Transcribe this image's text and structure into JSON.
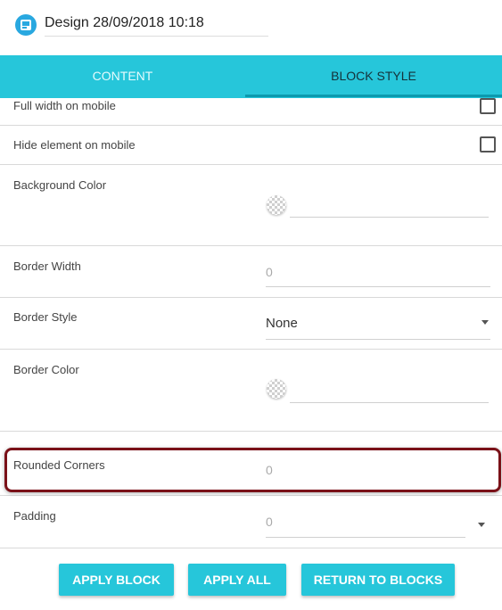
{
  "header": {
    "title": "Design 28/09/2018 10:18",
    "logo_icon": "design-logo-icon"
  },
  "tabs": [
    {
      "label": "CONTENT",
      "active": false
    },
    {
      "label": "BLOCK STYLE",
      "active": true
    }
  ],
  "rows": {
    "full_width_mobile": {
      "label": "Full width on mobile",
      "checked": false
    },
    "hide_on_mobile": {
      "label": "Hide element on mobile",
      "checked": false
    },
    "background_color": {
      "label": "Background Color",
      "value": ""
    },
    "border_width": {
      "label": "Border Width",
      "placeholder": "0"
    },
    "border_style": {
      "label": "Border Style",
      "value": "None"
    },
    "border_color": {
      "label": "Border Color",
      "value": ""
    },
    "rounded_corners": {
      "label": "Rounded Corners",
      "placeholder": "0",
      "highlighted": true
    },
    "padding": {
      "label": "Padding",
      "placeholder": "0"
    }
  },
  "buttons": {
    "apply_block": "APPLY BLOCK",
    "apply_all": "APPLY ALL",
    "return_to_blocks": "RETURN TO BLOCKS"
  },
  "colors": {
    "accent": "#26c6da",
    "highlight": "#7a1118"
  }
}
